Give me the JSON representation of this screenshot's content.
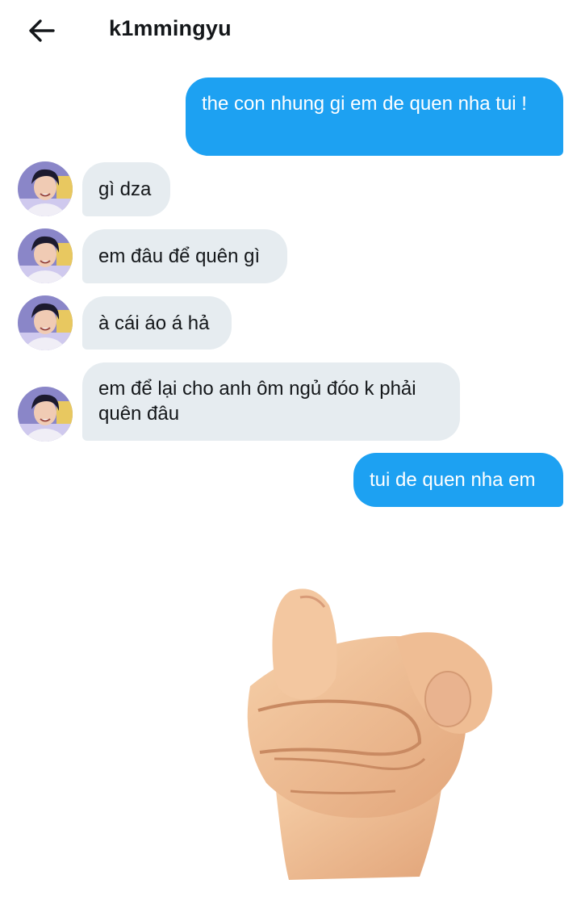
{
  "header": {
    "back_icon": "arrow-left-icon",
    "username": "k1mmingyu"
  },
  "messages": [
    {
      "direction": "sent",
      "text": "the con nhung gi em de quen nha tui !"
    },
    {
      "direction": "received",
      "text": "gì dza"
    },
    {
      "direction": "received",
      "text": "em đâu để quên gì"
    },
    {
      "direction": "received",
      "text": "à cái áo á hả"
    },
    {
      "direction": "received",
      "text": "em để lại cho anh ôm ngủ đóo k phải quên đâu"
    },
    {
      "direction": "sent",
      "text": "tui de quen nha em"
    }
  ],
  "sticker": {
    "icon": "pointing-hand-icon"
  },
  "colors": {
    "sent_bubble": "#1da1f2",
    "received_bubble": "#e6ecf0",
    "text": "#14171a"
  }
}
